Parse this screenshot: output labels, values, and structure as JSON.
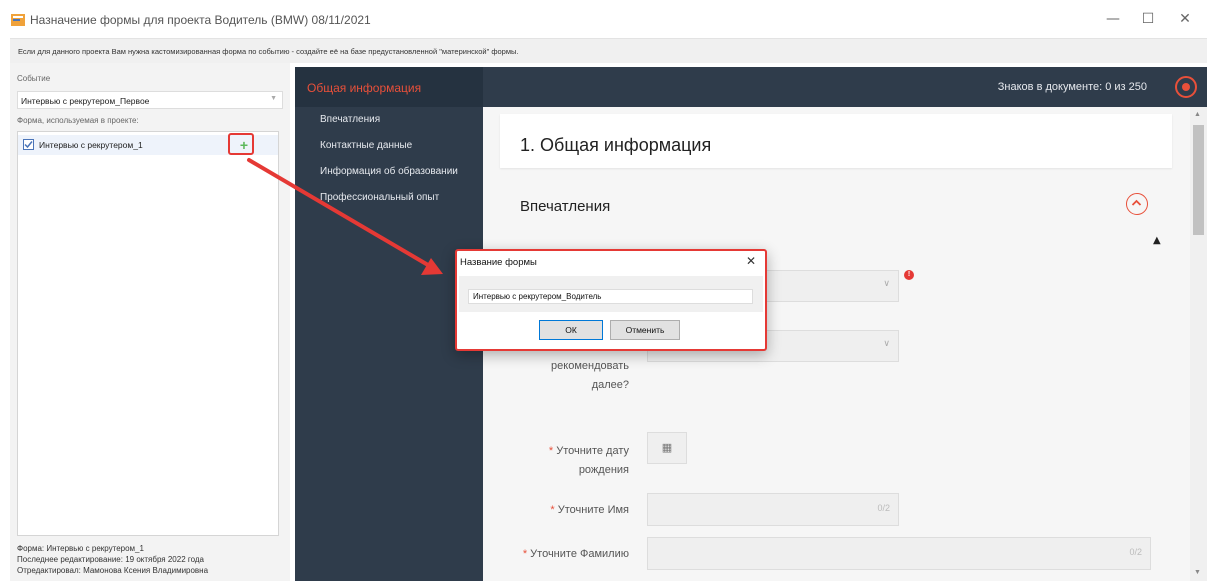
{
  "window": {
    "title": "Назначение формы для проекта Водитель (BMW) 08/11/2021",
    "minimize": "—",
    "maximize": "☐",
    "close": "✕"
  },
  "infobar": {
    "text": "Если для данного проекта Вам нужна кастомизированная форма по событию - создайте её на базе предустановленной \"материнской\" формы."
  },
  "left": {
    "event_label": "Событие",
    "event_value": "Интервью с рекрутером_Первое",
    "form_label": "Форма, используемая в проекте:",
    "form_item": "Интервью с рекрутером_1",
    "form_item_checked": true,
    "add_icon": "plus-icon",
    "footer": {
      "form": "Форма: Интервью с рекрутером_1",
      "last_edit": "Последнее редактирование: 19 октября 2022 года",
      "editor": "Отредактировал: Мамонова Ксения Владимировна"
    }
  },
  "nav": {
    "active": "Общая информация",
    "items": [
      "Впечатления",
      "Контактные данные",
      "Информация об образовании",
      "Профессиональный опыт"
    ]
  },
  "topbar": {
    "char_count": "Знаков в документе: 0 из 250"
  },
  "main": {
    "card_title": "1. Общая информация",
    "section_title": "Впечатления",
    "field_partial_label_1": "рекомендовать",
    "field_partial_label_2": "далее?",
    "birth_label_1": "Уточните дату",
    "birth_label_2": "рождения",
    "first_name_label": "Уточните Имя",
    "first_name_counter": "0/2",
    "last_name_label": "Уточните Фамилию",
    "last_name_counter": "0/2",
    "required_mark": "*"
  },
  "dialog": {
    "title": "Название формы",
    "input_value": "Интервью с рекрутером_Водитель",
    "ok_label": "ОК",
    "cancel_label": "Отменить"
  },
  "colors": {
    "dark_nav": "#2f3c4b",
    "accent": "#e8503a",
    "annotation_red": "#e53935"
  }
}
